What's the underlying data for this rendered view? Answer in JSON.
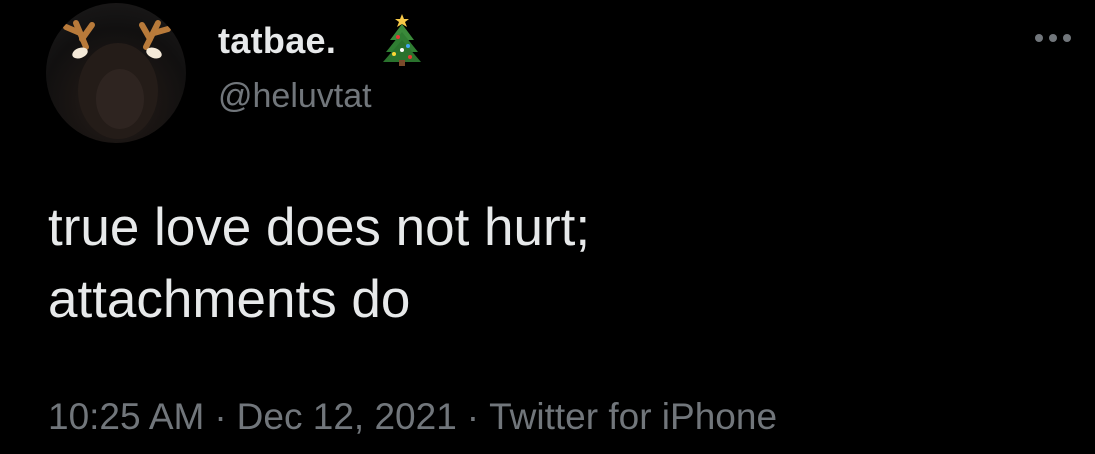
{
  "tweet": {
    "author": {
      "display_name": "tatbae.",
      "name_emoji": "christmas-tree-icon",
      "handle": "@heluvtat",
      "avatar": "reindeer-antlers-profile-photo"
    },
    "text_lines": [
      "true love does not hurt;",
      "attachments do"
    ],
    "time": "10:25 AM",
    "date": "Dec 12, 2021",
    "source": "Twitter for iPhone",
    "separator": "·"
  },
  "colors": {
    "background": "#000000",
    "primary_text": "#e7e9ea",
    "secondary_text": "#71767b"
  }
}
